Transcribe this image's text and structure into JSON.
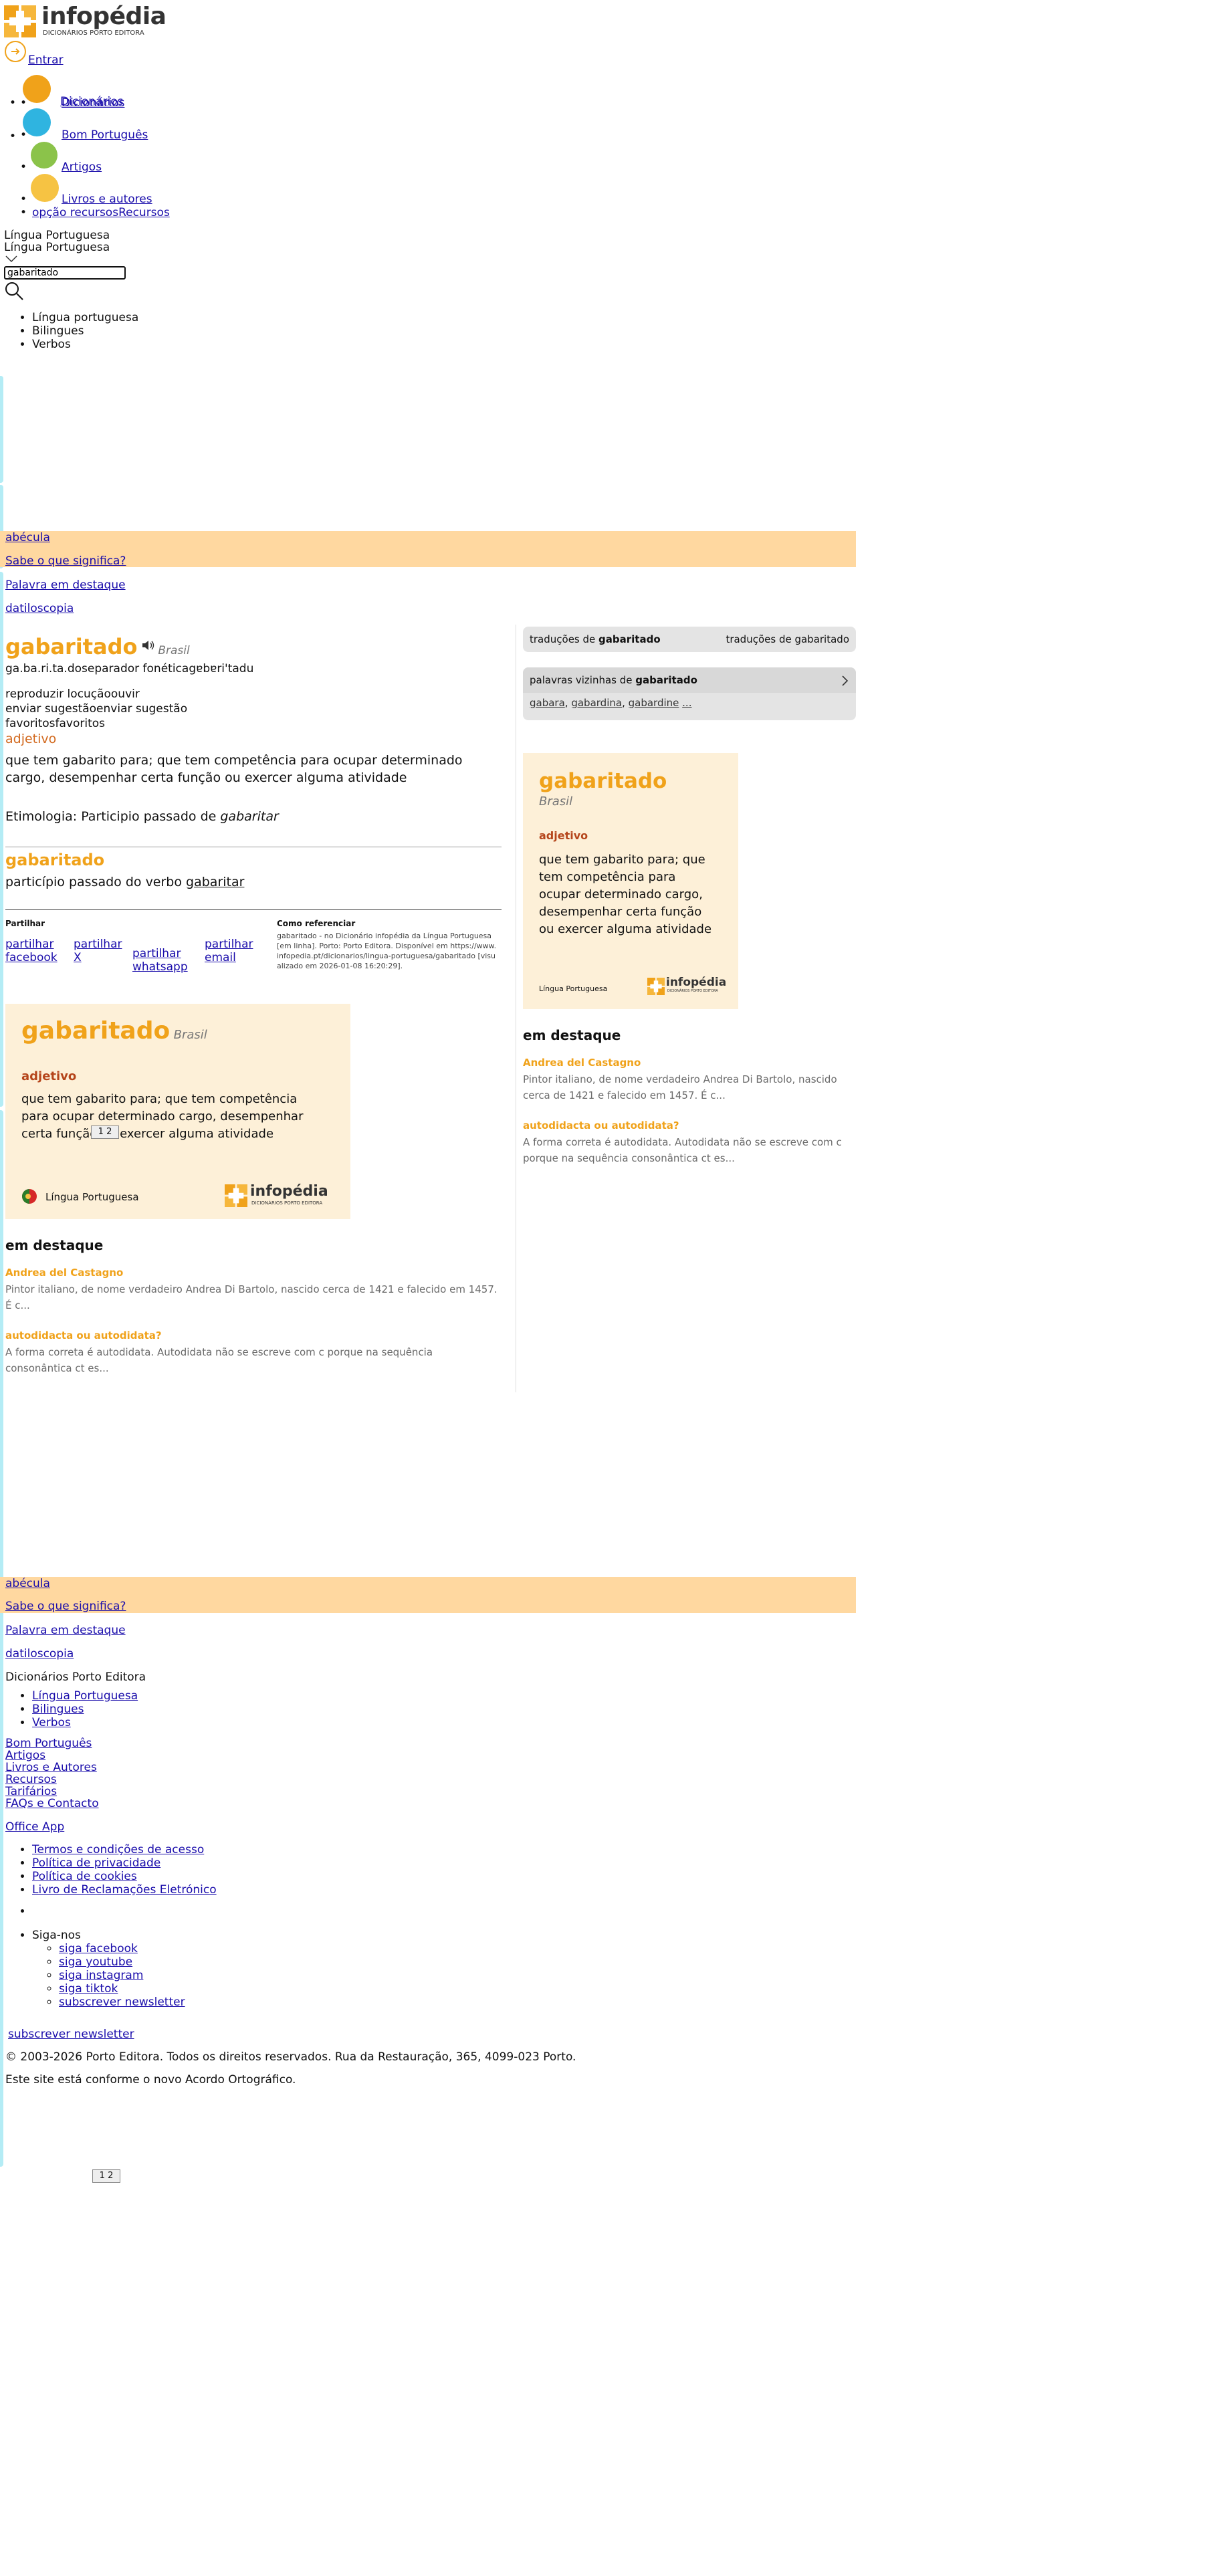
{
  "header": {
    "logo_word": "infopédia",
    "logo_sub": "DICIONÁRIOS PORTO EDITORA",
    "login": "Entrar"
  },
  "nav": [
    {
      "label": "Dicionários",
      "color": "#f0a21a"
    },
    {
      "label": "Bom Português",
      "color": "#2fb4e0"
    },
    {
      "label": "Artigos",
      "color": "#8bc34a"
    },
    {
      "label": "Livros e autores",
      "color": "#f6c343"
    }
  ],
  "nav_extra": {
    "alt": "opção recursos",
    "label": "Recursos"
  },
  "search": {
    "lang1": "Língua Portuguesa",
    "lang2": "Língua Portuguesa",
    "value": "gabaritado",
    "options": [
      "Língua portuguesa",
      "Bilingues",
      "Verbos"
    ]
  },
  "promo_top": {
    "word": "abécula",
    "question": "Sabe o que significa?",
    "highlight": "Palavra em destaque",
    "word2": "datiloscopia"
  },
  "entry": {
    "word": "gabaritado",
    "variant": "Brasil",
    "syllables": "ga.ba.ri.ta.do",
    "sep_alt": "separador fonética",
    "phonetic": "gɐbɐri'tadu",
    "audio_alt": "reproduzir locuçãoouvir",
    "suggest_alt": "enviar sugestãoenviar sugestão",
    "fav_alt": "favoritosfavoritos",
    "pos": "adjetivo",
    "definition": "que tem gabarito para; que tem competência para ocupar determinado cargo, desempenhar certa função ou exercer alguma atividade",
    "etym_label": "Etimologia: Participio passado de ",
    "etym_word": "gabaritar",
    "sub_word": "gabaritado",
    "sub_def_prefix": "particípio passado do verbo ",
    "sub_def_link": "gabaritar"
  },
  "share": {
    "title": "Partilhar",
    "items": [
      "partilhar facebook",
      "partilhar X",
      "partilhar whatsapp",
      "partilhar email"
    ]
  },
  "cite": {
    "title": "Como referenciar",
    "text": "gabaritado - no Dicionário infopédia da Língua Portuguesa [em linha]. Porto: Porto Editora. Disponível em https://www.infopedia.pt/dicionarios/lingua-portuguesa/gabaritado [visualizado em 2026-01-08 16:20:29]."
  },
  "card_main": {
    "word": "gabaritado",
    "variant": "Brasil",
    "pos": "adjetivo",
    "definition": "que tem gabarito para; que tem competência para ocupar determinado cargo, desempenhar certa função ou exercer alguma atividade",
    "lang": "Língua Portuguesa",
    "logo": "infopédia",
    "logo_sub": "DICIONÁRIOS PORTO EDITORA"
  },
  "destaque": {
    "title": "em destaque",
    "items": [
      {
        "title": "Andrea del Castagno",
        "text": "Pintor italiano, de nome verdadeiro Andrea Di Bartolo, nascido cerca de 1421 e falecido em 1457. É c..."
      },
      {
        "title": "autodidacta ou autodidata?",
        "text": "A forma correta é autodidata. Autodidata não se escreve com c porque na sequência consonântica ct es..."
      }
    ]
  },
  "sidebar": {
    "translations_prefix": "traduções de ",
    "translations_word": "gabaritado",
    "translations_alt": "traduções de gabaritado",
    "neighbors_prefix": "palavras vizinhas de ",
    "neighbors_word": "gabaritado",
    "neighbors": [
      "gabara",
      "gabardina",
      "gabardine"
    ],
    "ellipsis": "..."
  },
  "footer": {
    "brand": "Dicionários Porto Editora",
    "dict_links": [
      "Língua Portuguesa",
      "Bilingues",
      "Verbos"
    ],
    "links": [
      "Bom Português",
      "Artigos",
      "Livros e Autores",
      "Recursos",
      "Tarifários",
      "FAQs e Contacto"
    ],
    "office": "Office App",
    "legal": [
      "Termos e condições de acesso",
      "Política de privacidade",
      "Política de cookies",
      "Livro de Reclamações Eletrónico"
    ],
    "follow": "Siga-nos",
    "social": [
      "siga facebook",
      "siga youtube",
      "siga instagram",
      "siga tiktok"
    ],
    "newsletter": "subscrever newsletter",
    "newsletter2": "subscrever newsletter",
    "copyright": "© 2003-2026 Porto Editora. Todos os direitos reservados. Rua da Restauração, 365, 4099-023 Porto.",
    "acordo": "Este site está conforme o novo Acordo Ortográfico."
  },
  "pager": {
    "p1": "1",
    "p2": "2"
  }
}
